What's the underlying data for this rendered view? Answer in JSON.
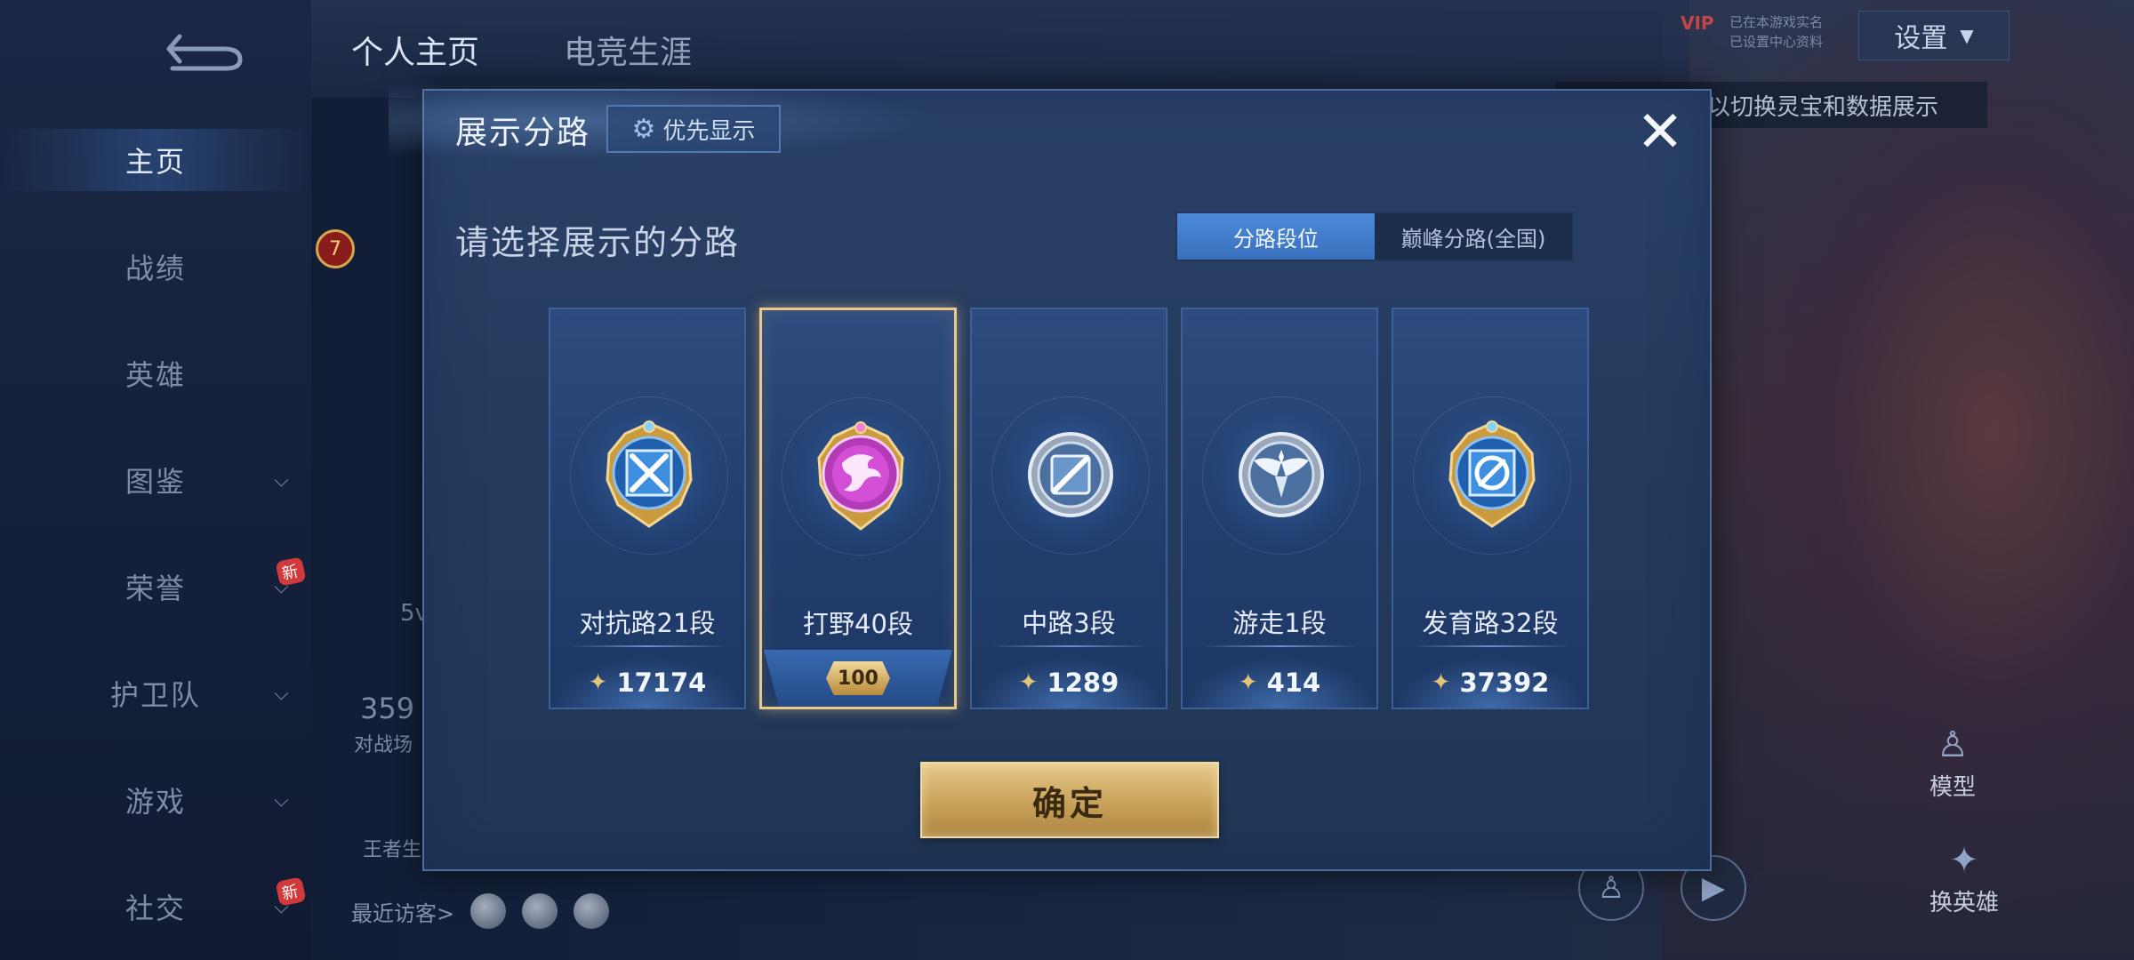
{
  "background": {
    "back_icon": "back-arrow-icon",
    "top_tabs": [
      "个人主页",
      "电竞生涯"
    ],
    "settings_label": "设置",
    "vip_label": "VIP",
    "vip_text_1": "已在本游戏实名",
    "vip_text_2": "已设置中心资料",
    "hint_text": "以切换灵宝和数据展示",
    "sidebar": {
      "items": [
        {
          "label": "主页",
          "active": true
        },
        {
          "label": "战绩"
        },
        {
          "label": "英雄"
        },
        {
          "label": "图鉴",
          "chevron": true
        },
        {
          "label": "荣誉",
          "chevron": true,
          "new": "新"
        },
        {
          "label": "护卫队",
          "chevron": true
        },
        {
          "label": "游戏",
          "chevron": true
        },
        {
          "label": "社交",
          "chevron": true,
          "new": "新"
        }
      ]
    },
    "level_badge": "7",
    "info_fragments": [
      "5v",
      "359",
      "对战场",
      "王者生"
    ],
    "recent_visitors_label": "最近访客>",
    "model_label": "模型",
    "switch_hero_label": "换英雄"
  },
  "modal": {
    "title": "展示分路",
    "priority_button": "优先显示",
    "close_icon": "close-icon",
    "subtitle": "请选择展示的分路",
    "tabs": [
      {
        "label": "分路段位",
        "active": true
      },
      {
        "label": "巅峰分路(全国)",
        "active": false
      }
    ],
    "lanes": [
      {
        "label": "对抗路21段",
        "score": "17174",
        "emblem": "clash-lane-emblem-icon",
        "selected": false
      },
      {
        "label": "打野40段",
        "rank": "100",
        "emblem": "jungle-dragon-emblem-icon",
        "selected": true
      },
      {
        "label": "中路3段",
        "score": "1289",
        "emblem": "mid-lane-emblem-icon",
        "selected": false
      },
      {
        "label": "游走1段",
        "score": "414",
        "emblem": "roam-wings-emblem-icon",
        "selected": false
      },
      {
        "label": "发育路32段",
        "score": "37392",
        "emblem": "farm-lane-emblem-icon",
        "selected": false
      }
    ],
    "confirm_button": "确定"
  },
  "colors": {
    "accent_blue": "#3a70be",
    "gold": "#c9a25a",
    "selected_border": "#e9c98a",
    "modal_bg": "#253b5e"
  }
}
